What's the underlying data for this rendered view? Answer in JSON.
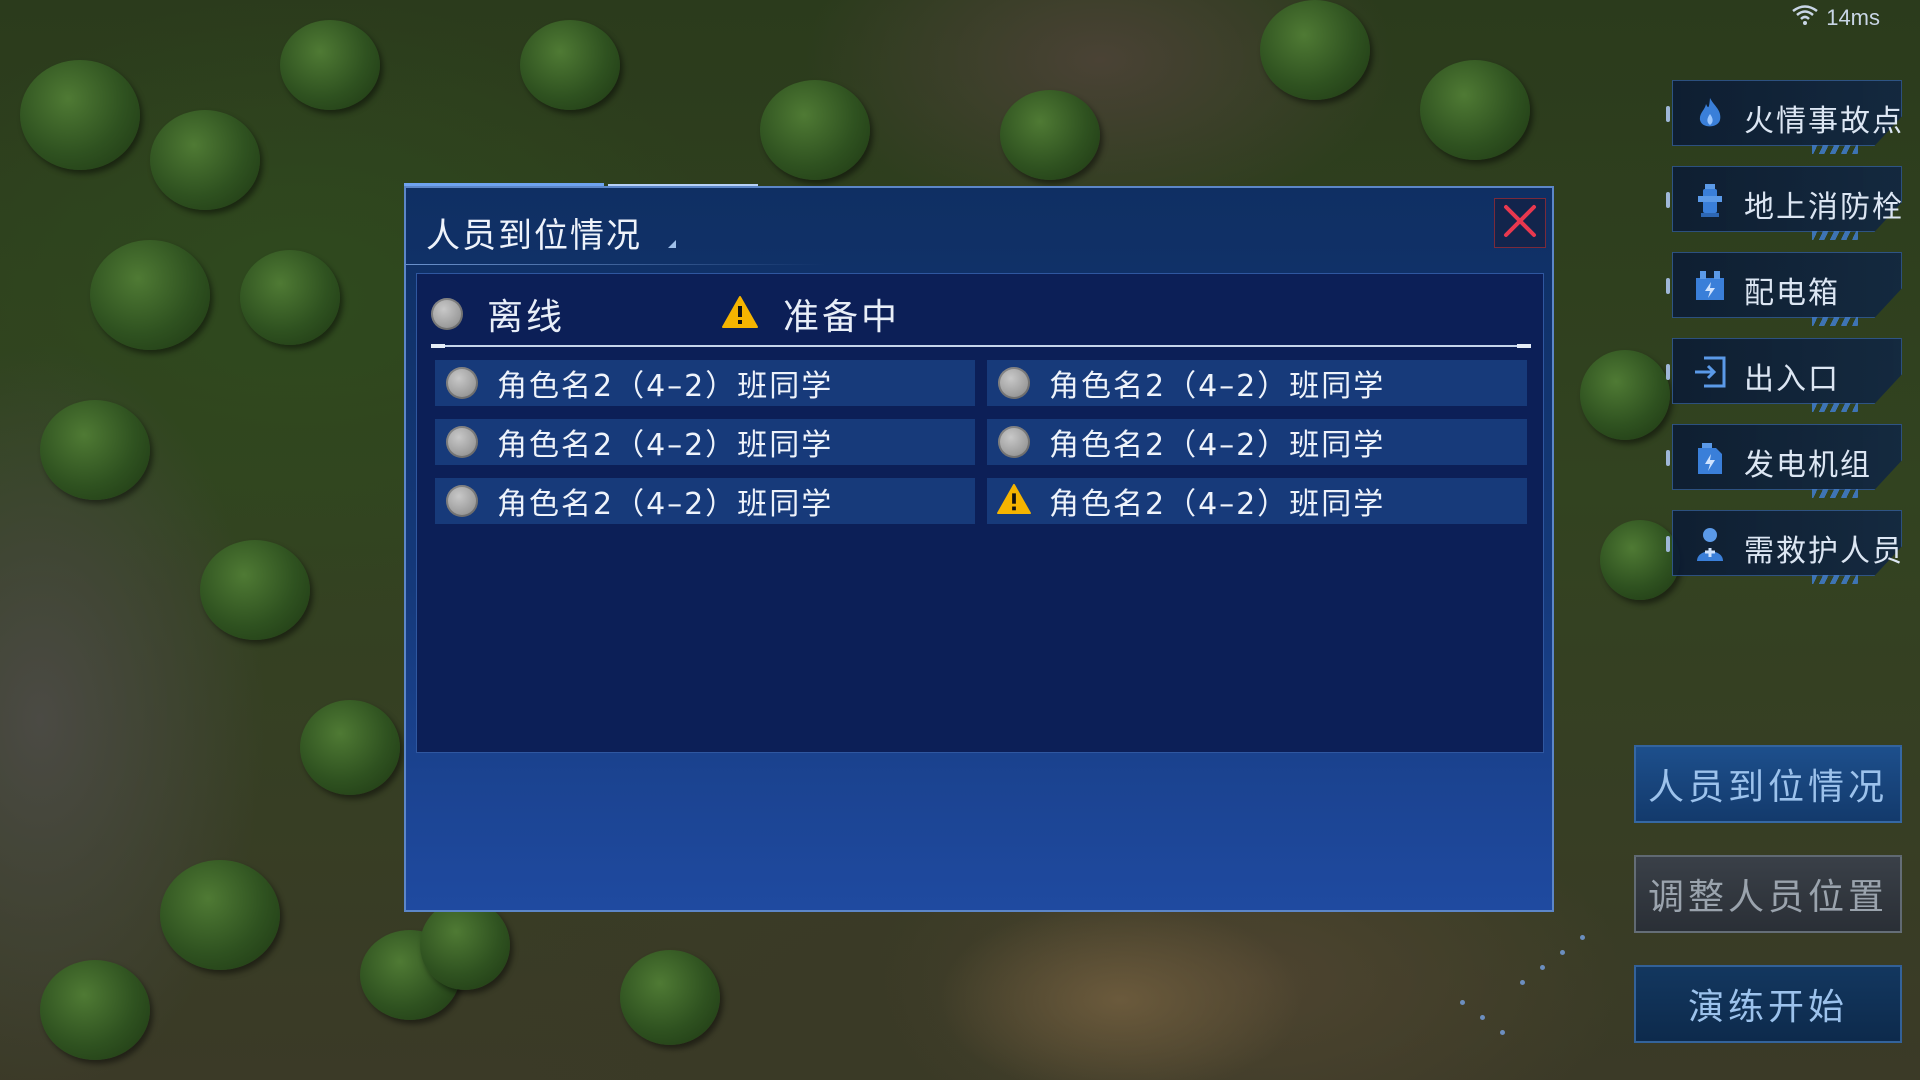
{
  "status_bar": {
    "ping": "14ms",
    "wifi_icon": "wifi-icon"
  },
  "side_menu": {
    "items": [
      {
        "label": "火情事故点",
        "icon": "fire-icon"
      },
      {
        "label": "地上消防栓",
        "icon": "hydrant-icon"
      },
      {
        "label": "配电箱",
        "icon": "power-box-icon"
      },
      {
        "label": "出入口",
        "icon": "exit-icon"
      },
      {
        "label": "发电机组",
        "icon": "generator-icon"
      },
      {
        "label": "需救护人员",
        "icon": "rescue-person-icon"
      }
    ]
  },
  "actions": {
    "personnel_status": "人员到位情况",
    "adjust_position": "调整人员位置",
    "start_drill": "演练开始"
  },
  "modal": {
    "title": "人员到位情况",
    "legend": {
      "offline": "离线",
      "preparing": "准备中"
    },
    "members": [
      {
        "name": "角色名2（4–2）班同学",
        "status": "offline"
      },
      {
        "name": "角色名2（4–2）班同学",
        "status": "offline"
      },
      {
        "name": "角色名2（4–2）班同学",
        "status": "offline"
      },
      {
        "name": "角色名2（4–2）班同学",
        "status": "offline"
      },
      {
        "name": "角色名2（4–2）班同学",
        "status": "offline"
      },
      {
        "name": "角色名2（4–2）班同学",
        "status": "preparing"
      }
    ]
  },
  "colors": {
    "warning": "#f5b400",
    "offline_dot": "#a6a6a6",
    "close_x": "#e8384f",
    "modal_bg": "#0c1f57",
    "row_bg": "#173a7a"
  }
}
